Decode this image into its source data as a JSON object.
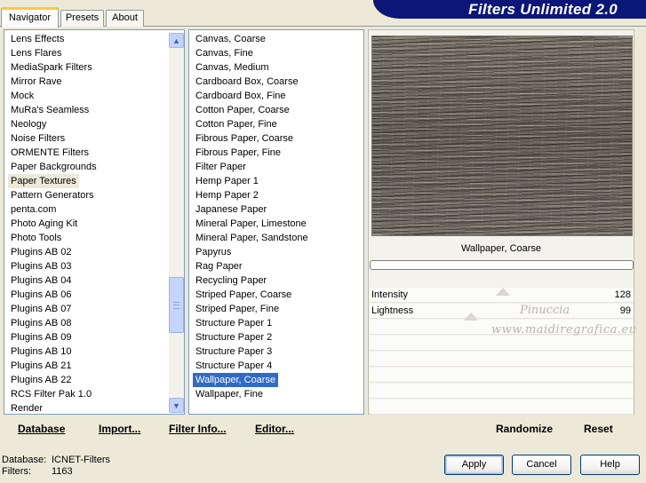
{
  "header": {
    "title": "Filters Unlimited 2.0",
    "tabs": [
      {
        "label": "Navigator",
        "active": true
      },
      {
        "label": "Presets",
        "active": false
      },
      {
        "label": "About",
        "active": false
      }
    ]
  },
  "categories": {
    "items": [
      "Lens Effects",
      "Lens Flares",
      "MediaSpark Filters",
      "Mirror Rave",
      "Mock",
      "MuRa's Seamless",
      "Neology",
      "Noise Filters",
      "ORMENTE Filters",
      "Paper Backgrounds",
      "Paper Textures",
      "Pattern Generators",
      "penta.com",
      "Photo Aging Kit",
      "Photo Tools",
      "Plugins AB 02",
      "Plugins AB 03",
      "Plugins AB 04",
      "Plugins AB 06",
      "Plugins AB 07",
      "Plugins AB 08",
      "Plugins AB 09",
      "Plugins AB 10",
      "Plugins AB 21",
      "Plugins AB 22",
      "RCS Filter Pak 1.0",
      "Render"
    ],
    "selected": "Paper Textures"
  },
  "filters": {
    "items": [
      "Canvas, Coarse",
      "Canvas, Fine",
      "Canvas, Medium",
      "Cardboard Box, Coarse",
      "Cardboard Box, Fine",
      "Cotton Paper, Coarse",
      "Cotton Paper, Fine",
      "Fibrous Paper, Coarse",
      "Fibrous Paper, Fine",
      "Filter Paper",
      "Hemp Paper 1",
      "Hemp Paper 2",
      "Japanese Paper",
      "Mineral Paper, Limestone",
      "Mineral Paper, Sandstone",
      "Papyrus",
      "Rag Paper",
      "Recycling Paper",
      "Striped Paper, Coarse",
      "Striped Paper, Fine",
      "Structure Paper 1",
      "Structure Paper 2",
      "Structure Paper 3",
      "Structure Paper 4",
      "Wallpaper, Coarse",
      "Wallpaper, Fine"
    ],
    "selected": "Wallpaper, Coarse"
  },
  "preview": {
    "filter_name": "Wallpaper, Coarse",
    "progress": 0,
    "params": [
      {
        "label": "Intensity",
        "value": "128"
      },
      {
        "label": "Lightness",
        "value": "99"
      }
    ],
    "watermark_line1": "Pinuccia",
    "watermark_line2": "www.maidiregrafica.eu"
  },
  "commands": {
    "database": "Database",
    "import": "Import...",
    "filter_info": "Filter Info...",
    "editor": "Editor...",
    "randomize": "Randomize",
    "reset": "Reset"
  },
  "footer": {
    "database_label": "Database:",
    "database_value": "ICNET-Filters",
    "filters_label": "Filters:",
    "filters_value": "1163",
    "apply": "Apply",
    "cancel": "Cancel",
    "help": "Help"
  },
  "colors": {
    "window_bg": "#ece9d8",
    "banner": "#0a1678",
    "selection": "#316ac5"
  }
}
